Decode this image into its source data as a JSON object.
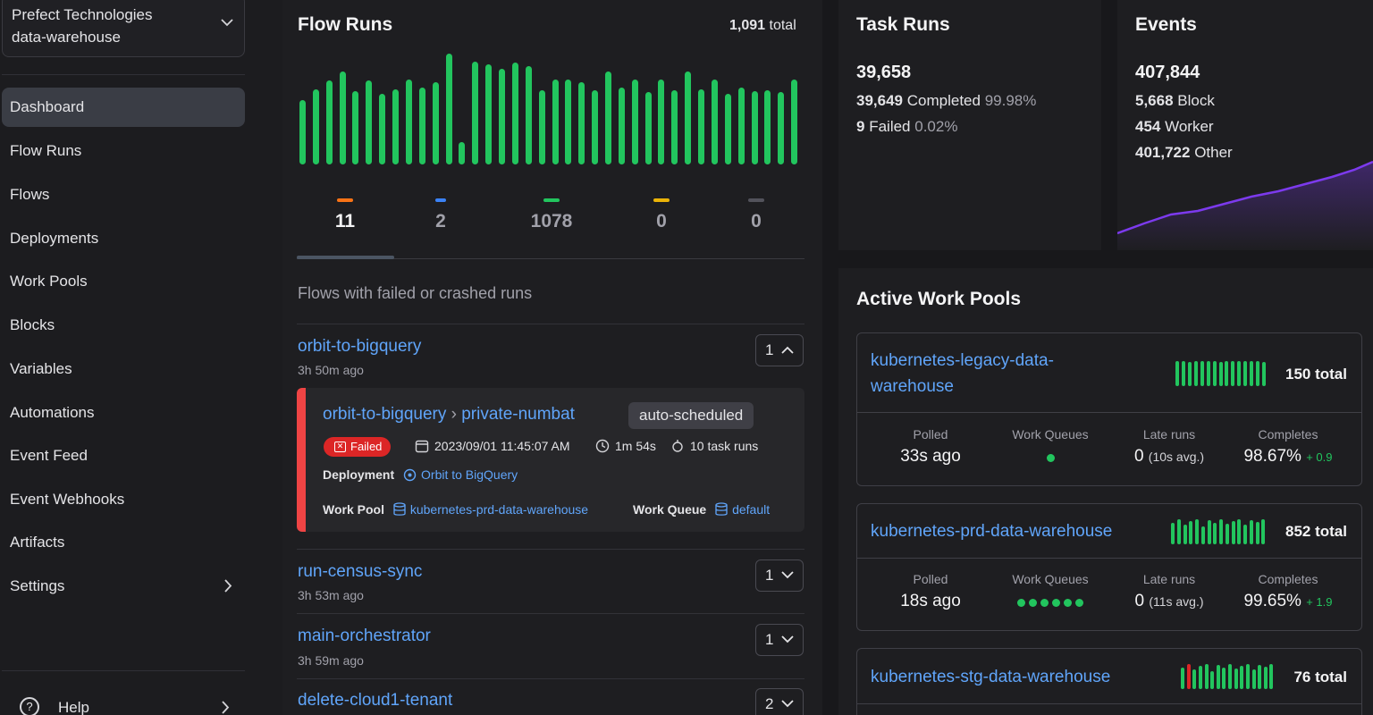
{
  "workspace": {
    "account": "Prefect Technologies",
    "name": "data-warehouse"
  },
  "nav": [
    {
      "label": "Dashboard"
    },
    {
      "label": "Flow Runs"
    },
    {
      "label": "Flows"
    },
    {
      "label": "Deployments"
    },
    {
      "label": "Work Pools"
    },
    {
      "label": "Blocks"
    },
    {
      "label": "Variables"
    },
    {
      "label": "Automations"
    },
    {
      "label": "Event Feed"
    },
    {
      "label": "Event Webhooks"
    },
    {
      "label": "Artifacts"
    },
    {
      "label": "Settings"
    }
  ],
  "help": {
    "label": "Help"
  },
  "flow_runs": {
    "title": "Flow Runs",
    "total_value": "1,091",
    "total_suffix": "total",
    "bar_heights": [
      0.58,
      0.68,
      0.76,
      0.84,
      0.66,
      0.76,
      0.64,
      0.68,
      0.77,
      0.69,
      0.74,
      1.0,
      0.2,
      0.93,
      0.9,
      0.86,
      0.92,
      0.89,
      0.67,
      0.77,
      0.77,
      0.74,
      0.67,
      0.84,
      0.69,
      0.77,
      0.65,
      0.77,
      0.67,
      0.84,
      0.68,
      0.77,
      0.64,
      0.69,
      0.66,
      0.67,
      0.65,
      0.77
    ],
    "states": [
      {
        "count": "11",
        "color": "#f97316"
      },
      {
        "count": "2",
        "color": "#3b82f6"
      },
      {
        "count": "1078",
        "color": "#22c55e"
      },
      {
        "count": "0",
        "color": "#eab308"
      },
      {
        "count": "0",
        "color": "#52525b"
      }
    ],
    "subheading": "Flows with failed or crashed runs",
    "flows": [
      {
        "name": "orbit-to-bigquery",
        "ago": "3h 50m ago",
        "count": "1"
      },
      {
        "name": "run-census-sync",
        "ago": "3h 53m ago",
        "count": "1"
      },
      {
        "name": "main-orchestrator",
        "ago": "3h 59m ago",
        "count": "1"
      },
      {
        "name": "delete-cloud1-tenant",
        "ago": "",
        "count": "2"
      }
    ],
    "failed_run": {
      "flow": "orbit-to-bigquery",
      "run": "private-numbat",
      "tag": "auto-scheduled",
      "state": "Failed",
      "start": "2023/09/01 11:45:07 AM",
      "duration": "1m 54s",
      "task_runs": "10 task runs",
      "deployment_label": "Deployment",
      "deployment": "Orbit to BigQuery",
      "work_pool_label": "Work Pool",
      "work_pool": "kubernetes-prd-data-warehouse",
      "work_queue_label": "Work Queue",
      "work_queue": "default"
    }
  },
  "task_runs": {
    "title": "Task Runs",
    "total": "39,658",
    "completed_count": "39,649",
    "completed_label": "Completed",
    "completed_pct": "99.98%",
    "failed_count": "9",
    "failed_label": "Failed",
    "failed_pct": "0.02%"
  },
  "events": {
    "title": "Events",
    "total": "407,844",
    "rows": [
      {
        "count": "5,668",
        "label": "Block"
      },
      {
        "count": "454",
        "label": "Worker"
      },
      {
        "count": "401,722",
        "label": "Other"
      }
    ],
    "line_color": "#7c3aed"
  },
  "work_pools": {
    "title": "Active Work Pools",
    "col_labels": {
      "polled": "Polled",
      "queues": "Work Queues",
      "late": "Late runs",
      "completes": "Completes"
    },
    "pools": [
      {
        "name_line1": "kubernetes-legacy-data-",
        "name_line2": "warehouse",
        "total": "150 total",
        "polled": "33s ago",
        "queue_dots": 1,
        "late": "0",
        "late_avg": "(10s avg.)",
        "completes": "98.67%",
        "delta": "+ 0.9"
      },
      {
        "name_line1": "kubernetes-prd-data-warehouse",
        "name_line2": "",
        "total": "852 total",
        "polled": "18s ago",
        "queue_dots": 6,
        "late": "0",
        "late_avg": "(11s avg.)",
        "completes": "99.65%",
        "delta": "+ 1.9"
      },
      {
        "name_line1": "kubernetes-stg-data-warehouse",
        "name_line2": "",
        "total": "76 total"
      }
    ]
  },
  "colors": {
    "success": "#22c55e",
    "failed": "#dc2626",
    "link": "#60a5fa",
    "bg": "#18181b"
  }
}
